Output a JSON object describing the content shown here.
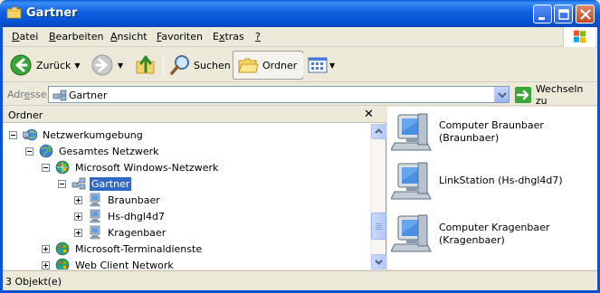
{
  "window": {
    "title": "Gartner"
  },
  "menu": [
    {
      "label": "Datei",
      "accel": "D",
      "rest": "atei"
    },
    {
      "label": "Bearbeiten",
      "accel": "B",
      "rest": "earbeiten"
    },
    {
      "label": "Ansicht",
      "accel": "A",
      "rest": "nsicht"
    },
    {
      "label": "Favoriten",
      "accel": "F",
      "rest": "avoriten"
    },
    {
      "label": "Extras",
      "accel": "x",
      "pre": "E",
      "rest": "tras"
    },
    {
      "label": "?",
      "accel": "?",
      "rest": ""
    }
  ],
  "toolbar": {
    "back_label": "Zurück",
    "search_label": "Suchen",
    "folders_label": "Ordner"
  },
  "address": {
    "label_pre": "Adr",
    "label_accel": "e",
    "label_post": "sse",
    "value": "Gartner",
    "go_label": "Wechseln zu"
  },
  "folder_pane": {
    "title": "Ordner",
    "tree": [
      {
        "label": "Netzwerkumgebung",
        "level": 0,
        "expander": "minus",
        "icon": "network-places-icon",
        "selected": false
      },
      {
        "label": "Gesamtes Netzwerk",
        "level": 1,
        "expander": "minus",
        "icon": "entire-network-icon",
        "selected": false
      },
      {
        "label": "Microsoft Windows-Netzwerk",
        "level": 2,
        "expander": "minus",
        "icon": "windows-network-icon",
        "selected": false
      },
      {
        "label": "Gartner",
        "level": 3,
        "expander": "minus",
        "icon": "workgroup-icon",
        "selected": true
      },
      {
        "label": "Braunbaer",
        "level": 4,
        "expander": "plus",
        "icon": "computer-icon",
        "selected": false
      },
      {
        "label": "Hs-dhgl4d7",
        "level": 4,
        "expander": "plus",
        "icon": "computer-icon",
        "selected": false
      },
      {
        "label": "Kragenbaer",
        "level": 4,
        "expander": "plus",
        "icon": "computer-icon",
        "selected": false
      },
      {
        "label": "Microsoft-Terminaldienste",
        "level": 2,
        "expander": "plus",
        "icon": "windows-network-icon",
        "selected": false
      },
      {
        "label": "Web Client Network",
        "level": 2,
        "expander": "plus",
        "icon": "windows-network-icon",
        "selected": false
      }
    ]
  },
  "content": {
    "items": [
      {
        "line1": "Computer Braunbaer",
        "line2": "(Braunbaer)"
      },
      {
        "line1": "LinkStation (Hs-dhgl4d7)",
        "line2": ""
      },
      {
        "line1": "Computer Kragenbaer",
        "line2": "(Kragenbaer)"
      }
    ]
  },
  "status": {
    "text": "3 Objekt(e)"
  },
  "colors": {
    "titlebar": "#0553d3",
    "selection": "#316ac5",
    "chrome": "#ece9d8"
  }
}
